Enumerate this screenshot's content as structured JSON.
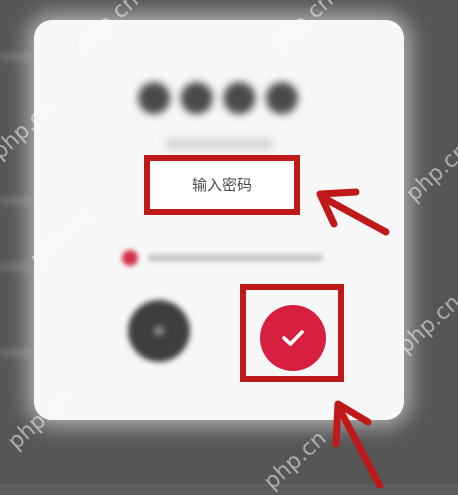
{
  "password_dialog": {
    "input": {
      "placeholder": "输入密码",
      "value": ""
    },
    "confirm_button": {
      "icon": "checkmark-icon",
      "color": "#d81f3f"
    },
    "cancel_button": {
      "icon": "close-icon"
    },
    "annotation_color": "#c0191a"
  },
  "watermark": {
    "text": "php.cn"
  }
}
